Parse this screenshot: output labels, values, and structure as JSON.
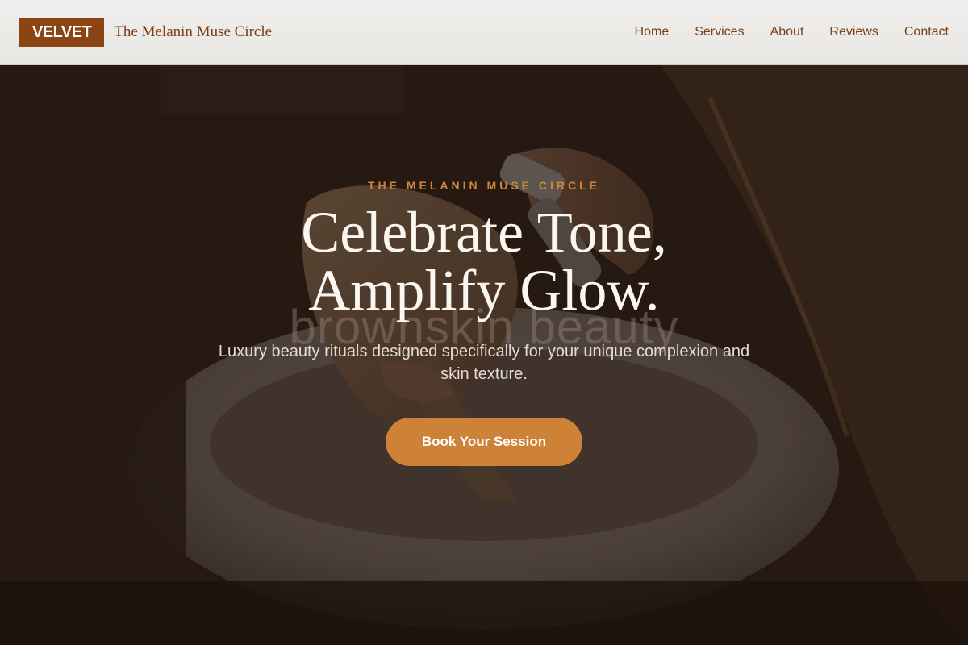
{
  "header": {
    "logo": "VELVET",
    "brand_name": "The Melanin Muse Circle",
    "nav": [
      {
        "label": "Home"
      },
      {
        "label": "Services"
      },
      {
        "label": "About"
      },
      {
        "label": "Reviews"
      },
      {
        "label": "Contact"
      }
    ]
  },
  "hero": {
    "eyebrow": "THE MELANIN MUSE CIRCLE",
    "headline_line1": "Celebrate Tone,",
    "headline_line2": "Amplify Glow.",
    "image_watermark": "brownskin beauty",
    "subtitle": "Luxury beauty rituals designed specifically for your unique complexion and skin texture.",
    "cta_label": "Book Your Session"
  },
  "colors": {
    "brand": "#8a4513",
    "accent": "#cd8237",
    "header_bg": "#eceae7",
    "hero_overlay": "#1e120a"
  }
}
